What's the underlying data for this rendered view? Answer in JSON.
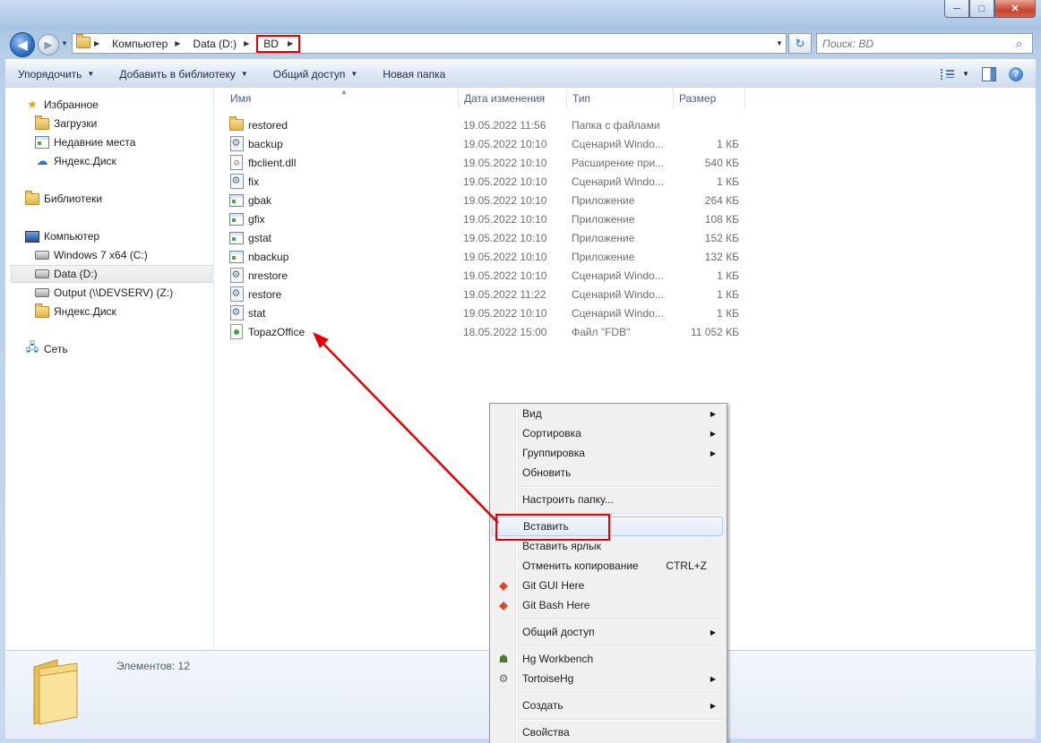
{
  "window": {
    "caption_buttons": {
      "minimize": "─",
      "maximize": "□",
      "close": "✕"
    }
  },
  "address_bar": {
    "back_glyph": "◀",
    "forward_glyph": "▶",
    "crumbs": [
      "Компьютер",
      "Data (D:)",
      "BD"
    ],
    "search_placeholder": "Поиск: BD"
  },
  "command_bar": {
    "items": [
      "Упорядочить",
      "Добавить в библиотеку",
      "Общий доступ",
      "Новая папка"
    ],
    "help": "?"
  },
  "nav_pane": {
    "favorites": "Избранное",
    "downloads": "Загрузки",
    "recent": "Недавние места",
    "yadisk_fav": "Яндекс.Диск",
    "libraries": "Библиотеки",
    "computer": "Компьютер",
    "drive_c": "Windows 7 x64 (C:)",
    "drive_d": "Data (D:)",
    "drive_z": "Output (\\\\DEVSERV) (Z:)",
    "yadisk_pc": "Яндекс.Диск",
    "network": "Сеть"
  },
  "columns": {
    "name": "Имя",
    "date": "Дата изменения",
    "type": "Тип",
    "size": "Размер"
  },
  "files": [
    {
      "name": "restored",
      "date": "19.05.2022 11:56",
      "type": "Папка с файлами",
      "size": "",
      "icon": "folder-icon"
    },
    {
      "name": "backup",
      "date": "19.05.2022 10:10",
      "type": "Сценарий Windo...",
      "size": "1 КБ",
      "icon": "script-icon"
    },
    {
      "name": "fbclient.dll",
      "date": "19.05.2022 10:10",
      "type": "Расширение при...",
      "size": "540 КБ",
      "icon": "dll-icon"
    },
    {
      "name": "fix",
      "date": "19.05.2022 10:10",
      "type": "Сценарий Windo...",
      "size": "1 КБ",
      "icon": "script-icon"
    },
    {
      "name": "gbak",
      "date": "19.05.2022 10:10",
      "type": "Приложение",
      "size": "264 КБ",
      "icon": "app-icon"
    },
    {
      "name": "gfix",
      "date": "19.05.2022 10:10",
      "type": "Приложение",
      "size": "108 КБ",
      "icon": "app-icon"
    },
    {
      "name": "gstat",
      "date": "19.05.2022 10:10",
      "type": "Приложение",
      "size": "152 КБ",
      "icon": "app-icon"
    },
    {
      "name": "nbackup",
      "date": "19.05.2022 10:10",
      "type": "Приложение",
      "size": "132 КБ",
      "icon": "app-icon"
    },
    {
      "name": "nrestore",
      "date": "19.05.2022 10:10",
      "type": "Сценарий Windo...",
      "size": "1 КБ",
      "icon": "script-icon"
    },
    {
      "name": "restore",
      "date": "19.05.2022 11:22",
      "type": "Сценарий Windo...",
      "size": "1 КБ",
      "icon": "script-icon"
    },
    {
      "name": "stat",
      "date": "19.05.2022 10:10",
      "type": "Сценарий Windo...",
      "size": "1 КБ",
      "icon": "script-icon"
    },
    {
      "name": "TopazOffice",
      "date": "18.05.2022 15:00",
      "type": "Файл \"FDB\"",
      "size": "11 052 КБ",
      "icon": "fdb-icon"
    }
  ],
  "details": {
    "count": "Элементов: 12"
  },
  "context_menu": {
    "view": "Вид",
    "sort": "Сортировка",
    "group": "Группировка",
    "refresh": "Обновить",
    "customize": "Настроить папку...",
    "paste": "Вставить",
    "paste_shortcut": "Вставить ярлык",
    "undo_copy": "Отменить копирование",
    "undo_copy_shortcut": "CTRL+Z",
    "git_gui": "Git GUI Here",
    "git_bash": "Git Bash Here",
    "share": "Общий доступ",
    "hg_workbench": "Hg Workbench",
    "tortoisehg": "TortoiseHg",
    "create": "Создать",
    "properties": "Свойства"
  },
  "annotation_color": "#e60000"
}
